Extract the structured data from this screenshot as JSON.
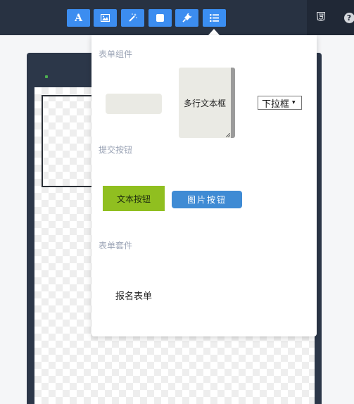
{
  "toolbar": {
    "tools": [
      {
        "name": "text-tool",
        "icon": "text-a-icon",
        "glyph": "A"
      },
      {
        "name": "image-tool",
        "icon": "image-icon"
      },
      {
        "name": "effects-tool",
        "icon": "magic-wand-icon"
      },
      {
        "name": "shape-tool",
        "icon": "square-icon"
      },
      {
        "name": "plugin-tool",
        "icon": "plug-icon"
      },
      {
        "name": "form-tool",
        "icon": "list-icon",
        "active": true
      }
    ],
    "right": [
      {
        "name": "html5-button",
        "icon": "html5-shield-icon"
      },
      {
        "name": "help-button",
        "icon": "question-circle-icon",
        "glyph": "?"
      }
    ]
  },
  "form_panel": {
    "sections": {
      "form_components": "表单组件",
      "submit_buttons": "提交按钮",
      "form_suites": "表单套件"
    },
    "components": {
      "textarea_label": "多行文本框",
      "select_value": "下拉框",
      "select_arrow": "▾"
    },
    "buttons": {
      "text_button": "文本按钮",
      "image_button": "图片按钮"
    },
    "suites": {
      "signup_form": "报名表单"
    }
  },
  "colors": {
    "topbar": "#283242",
    "accent": "#3c8df0",
    "text_button": "#90bf20",
    "image_button": "#3f8bd4",
    "section_title": "#9aa3b5"
  }
}
